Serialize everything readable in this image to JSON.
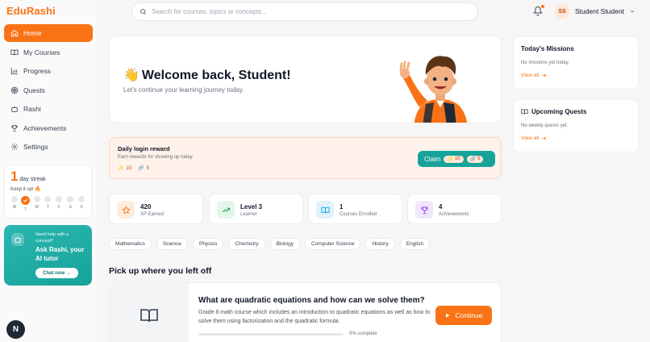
{
  "app": {
    "logo_text": "EduRashi",
    "brand_color": "#f97316",
    "accent_color": "#17a39a"
  },
  "sidebar": {
    "items": [
      {
        "label": "Home",
        "icon": "home-icon",
        "active": true
      },
      {
        "label": "My Courses",
        "icon": "book-open-icon"
      },
      {
        "label": "Progress",
        "icon": "bar-chart-icon"
      },
      {
        "label": "Quests",
        "icon": "target-icon"
      },
      {
        "label": "Rashi",
        "icon": "robot-icon"
      },
      {
        "label": "Achievements",
        "icon": "trophy-icon"
      },
      {
        "label": "Settings",
        "icon": "gear-icon"
      }
    ],
    "streak": {
      "count": "1",
      "unit": "day streak",
      "subtitle": "Keep it up! 🔥",
      "days": [
        "M",
        "T",
        "W",
        "T",
        "F",
        "S",
        "S"
      ],
      "active_day_index": 1
    },
    "tutor": {
      "help_text": "Need help with a concept?",
      "title": "Ask Rashi, your AI tutor",
      "button": "Chat now →"
    },
    "corner_badge": "N"
  },
  "header": {
    "search_placeholder": "Search for courses, topics or concepts...",
    "user_initials": "SS",
    "user_name": "Student Student"
  },
  "welcome": {
    "wave": "👋",
    "title": "Welcome back, Student!",
    "subtitle": "Let's continue your learning journey today."
  },
  "missions": {
    "title": "Today's Missions",
    "empty": "No missions yet today.",
    "view_all": "View all"
  },
  "quests": {
    "title": "Upcoming Quests",
    "empty": "No weekly quests yet.",
    "view_all": "View all"
  },
  "reward": {
    "title": "Daily login reward",
    "subtitle": "Earn rewards for showing up today.",
    "xp": "10",
    "coins": "5",
    "claim_label": "Claim",
    "claim_xp": "10",
    "claim_coins": "5"
  },
  "stats": [
    {
      "value": "420",
      "label": "XP Earned",
      "icon": "star-icon",
      "bg": "#fdecdf",
      "fg": "#f97316"
    },
    {
      "value": "Level 3",
      "label": "Learner",
      "icon": "trending-up-icon",
      "bg": "#e2f6ea",
      "fg": "#16a34a"
    },
    {
      "value": "1",
      "label": "Courses Enrolled",
      "icon": "book-open-icon",
      "bg": "#e1f2fb",
      "fg": "#0ea5e9"
    },
    {
      "value": "4",
      "label": "Achievements",
      "icon": "trophy-icon",
      "bg": "#f1e7fb",
      "fg": "#9333ea"
    }
  ],
  "subjects": [
    "Mathematics",
    "Science",
    "Physics",
    "Chemistry",
    "Biology",
    "Computer Science",
    "History",
    "English"
  ],
  "continue": {
    "heading": "Pick up where you left off",
    "course_title": "What are quadratic equations and how can we solve them?",
    "course_desc": "Grade 8 math course which includes an introduction to quadratic equations as well as how to solve them using factorization and the quadratic formula.",
    "progress_pct": 0,
    "progress_label": "0% complete",
    "button": "Continue"
  }
}
